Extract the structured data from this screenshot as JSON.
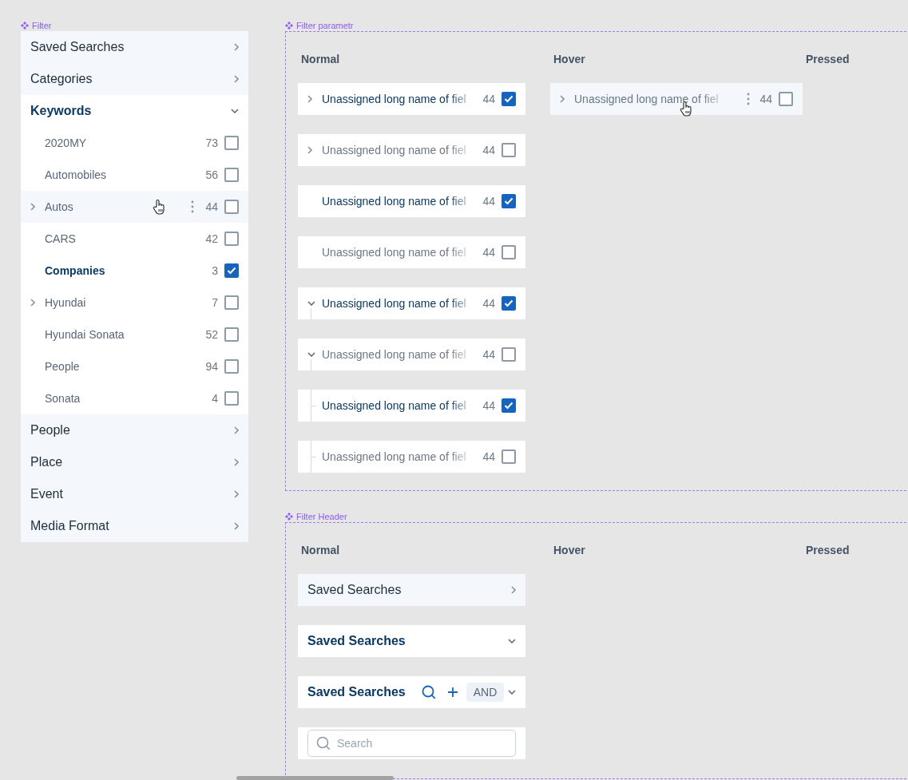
{
  "filter": {
    "title": "Filter",
    "sections": [
      {
        "label": "Saved Searches",
        "expanded": false
      },
      {
        "label": "Categories",
        "expanded": false
      },
      {
        "label": "Keywords",
        "expanded": true,
        "items": [
          {
            "label": "2020MY",
            "count": "73",
            "checked": false,
            "has_children": false,
            "hovered": false
          },
          {
            "label": "Automobiles",
            "count": "56",
            "checked": false,
            "has_children": false,
            "hovered": false
          },
          {
            "label": "Autos",
            "count": "44",
            "checked": false,
            "has_children": true,
            "hovered": true
          },
          {
            "label": "CARS",
            "count": "42",
            "checked": false,
            "has_children": false,
            "hovered": false
          },
          {
            "label": "Companies",
            "count": "3",
            "checked": true,
            "has_children": false,
            "hovered": false
          },
          {
            "label": "Hyundai",
            "count": "7",
            "checked": false,
            "has_children": true,
            "hovered": false
          },
          {
            "label": "Hyundai Sonata",
            "count": "52",
            "checked": false,
            "has_children": false,
            "hovered": false
          },
          {
            "label": "People",
            "count": "94",
            "checked": false,
            "has_children": false,
            "hovered": false
          },
          {
            "label": "Sonata",
            "count": "4",
            "checked": false,
            "has_children": false,
            "hovered": false
          }
        ]
      },
      {
        "label": "People",
        "expanded": false
      },
      {
        "label": "Place",
        "expanded": false
      },
      {
        "label": "Event",
        "expanded": false
      },
      {
        "label": "Media Format",
        "expanded": false
      }
    ]
  },
  "filter_parameter": {
    "title": "Filter parametr",
    "columns": [
      "Normal",
      "Hover",
      "Pressed"
    ],
    "normal_rows": [
      {
        "kind": "collapsed",
        "label": "Unassigned long name of fiel",
        "count": "44",
        "checked": true,
        "hovered": false
      },
      {
        "kind": "collapsed",
        "label": "Unassigned long name of fiel",
        "count": "44",
        "checked": false,
        "hovered": false
      },
      {
        "kind": "leaf",
        "label": "Unassigned long name of fiel",
        "count": "44",
        "checked": true,
        "hovered": false
      },
      {
        "kind": "leaf",
        "label": "Unassigned long name of fiel",
        "count": "44",
        "checked": false,
        "hovered": false
      },
      {
        "kind": "expanded",
        "label": "Unassigned long name of fiel",
        "count": "44",
        "checked": true,
        "hovered": false
      },
      {
        "kind": "expanded",
        "label": "Unassigned long name of fiel",
        "count": "44",
        "checked": false,
        "hovered": false
      },
      {
        "kind": "child",
        "label": "Unassigned long name of fiel",
        "count": "44",
        "checked": true,
        "hovered": false
      },
      {
        "kind": "child",
        "label": "Unassigned long name of fiel",
        "count": "44",
        "checked": false,
        "hovered": false
      }
    ],
    "hover_rows": [
      {
        "kind": "collapsed",
        "label": "Unassigned long name of fiel",
        "count": "44",
        "checked": false,
        "hovered": true
      }
    ]
  },
  "filter_header": {
    "title": "Filter Header",
    "columns": [
      "Normal",
      "Hover",
      "Pressed"
    ],
    "normal_rows": [
      {
        "kind": "collapsed",
        "label": "Saved Searches"
      },
      {
        "kind": "expanded",
        "label": "Saved Searches"
      },
      {
        "kind": "actions",
        "label": "Saved Searches",
        "operator": "AND"
      },
      {
        "kind": "search",
        "placeholder": "Search"
      }
    ]
  }
}
